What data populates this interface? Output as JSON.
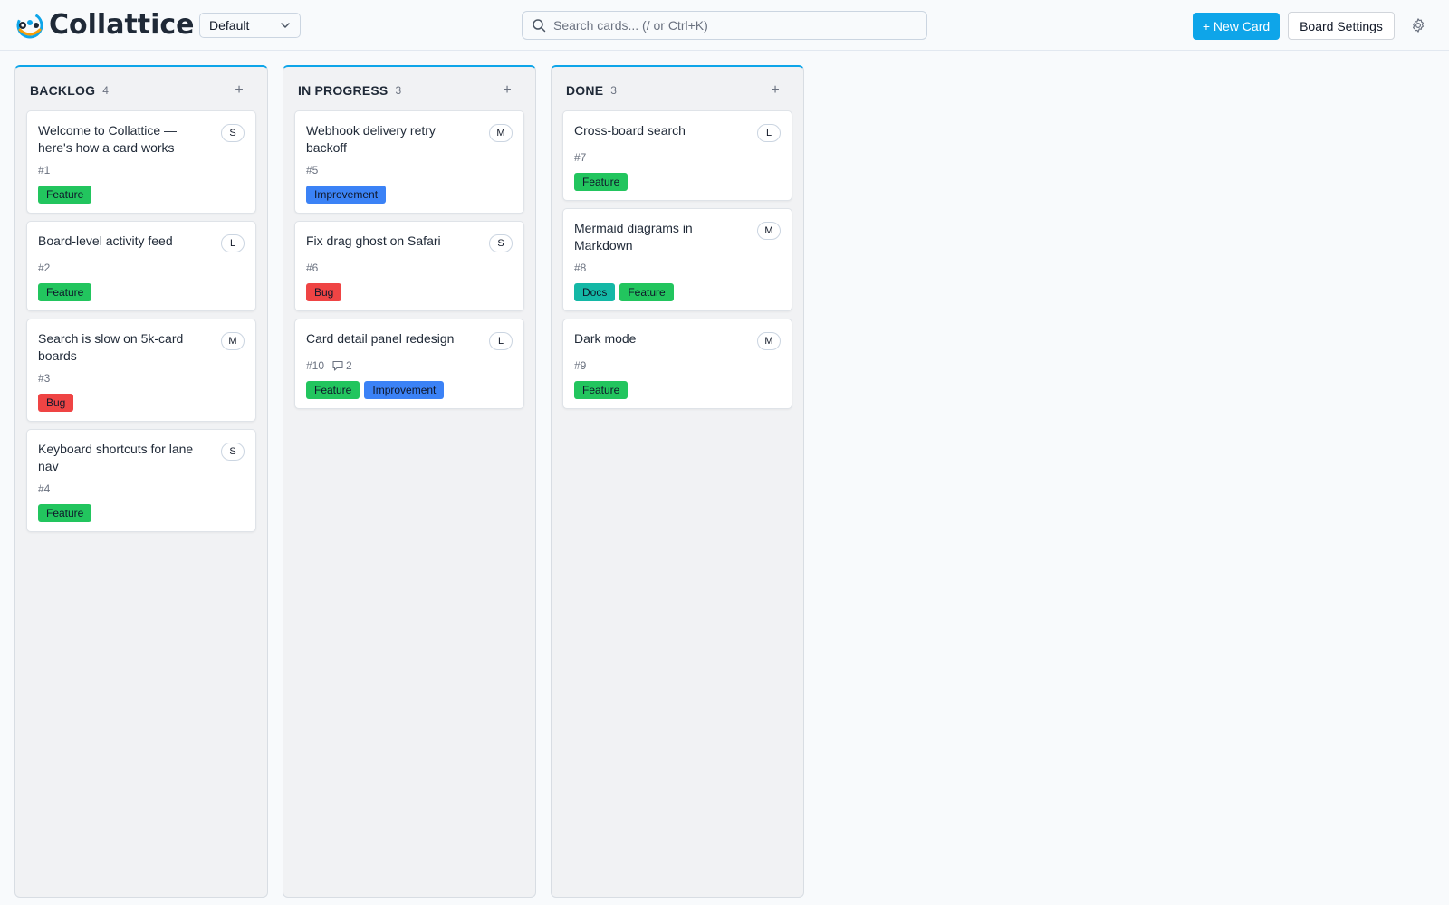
{
  "app": {
    "logo_text": "Collattice",
    "board_select": "Default",
    "search_placeholder": "Search cards... (/ or Ctrl+K)",
    "new_card_label": "+ New Card",
    "board_settings_label": "Board Settings"
  },
  "colors": {
    "accent": "#0ea5e9",
    "Feature": "#22c55e",
    "Improvement": "#3b82f6",
    "Bug": "#ef4444",
    "Docs": "#14b8a6"
  },
  "lanes": [
    {
      "title": "BACKLOG",
      "count": "4",
      "add": "+",
      "cards": [
        {
          "title": "Welcome to Collattice — here's how a card works",
          "size": "S",
          "id": "#1",
          "tags": [
            "Feature"
          ]
        },
        {
          "title": "Board-level activity feed",
          "size": "L",
          "id": "#2",
          "tags": [
            "Feature"
          ]
        },
        {
          "title": "Search is slow on 5k-card boards",
          "size": "M",
          "id": "#3",
          "tags": [
            "Bug"
          ]
        },
        {
          "title": "Keyboard shortcuts for lane nav",
          "size": "S",
          "id": "#4",
          "tags": [
            "Feature"
          ]
        }
      ]
    },
    {
      "title": "IN PROGRESS",
      "count": "3",
      "add": "+",
      "cards": [
        {
          "title": "Webhook delivery retry backoff",
          "size": "M",
          "id": "#5",
          "tags": [
            "Improvement"
          ]
        },
        {
          "title": "Fix drag ghost on Safari",
          "size": "S",
          "id": "#6",
          "tags": [
            "Bug"
          ]
        },
        {
          "title": "Card detail panel redesign",
          "size": "L",
          "id": "#10",
          "comments": "2",
          "tags": [
            "Feature",
            "Improvement"
          ]
        }
      ]
    },
    {
      "title": "DONE",
      "count": "3",
      "add": "+",
      "cards": [
        {
          "title": "Cross-board search",
          "size": "L",
          "id": "#7",
          "tags": [
            "Feature"
          ]
        },
        {
          "title": "Mermaid diagrams in Markdown",
          "size": "M",
          "id": "#8",
          "tags": [
            "Docs",
            "Feature"
          ]
        },
        {
          "title": "Dark mode",
          "size": "M",
          "id": "#9",
          "tags": [
            "Feature"
          ]
        }
      ]
    }
  ]
}
